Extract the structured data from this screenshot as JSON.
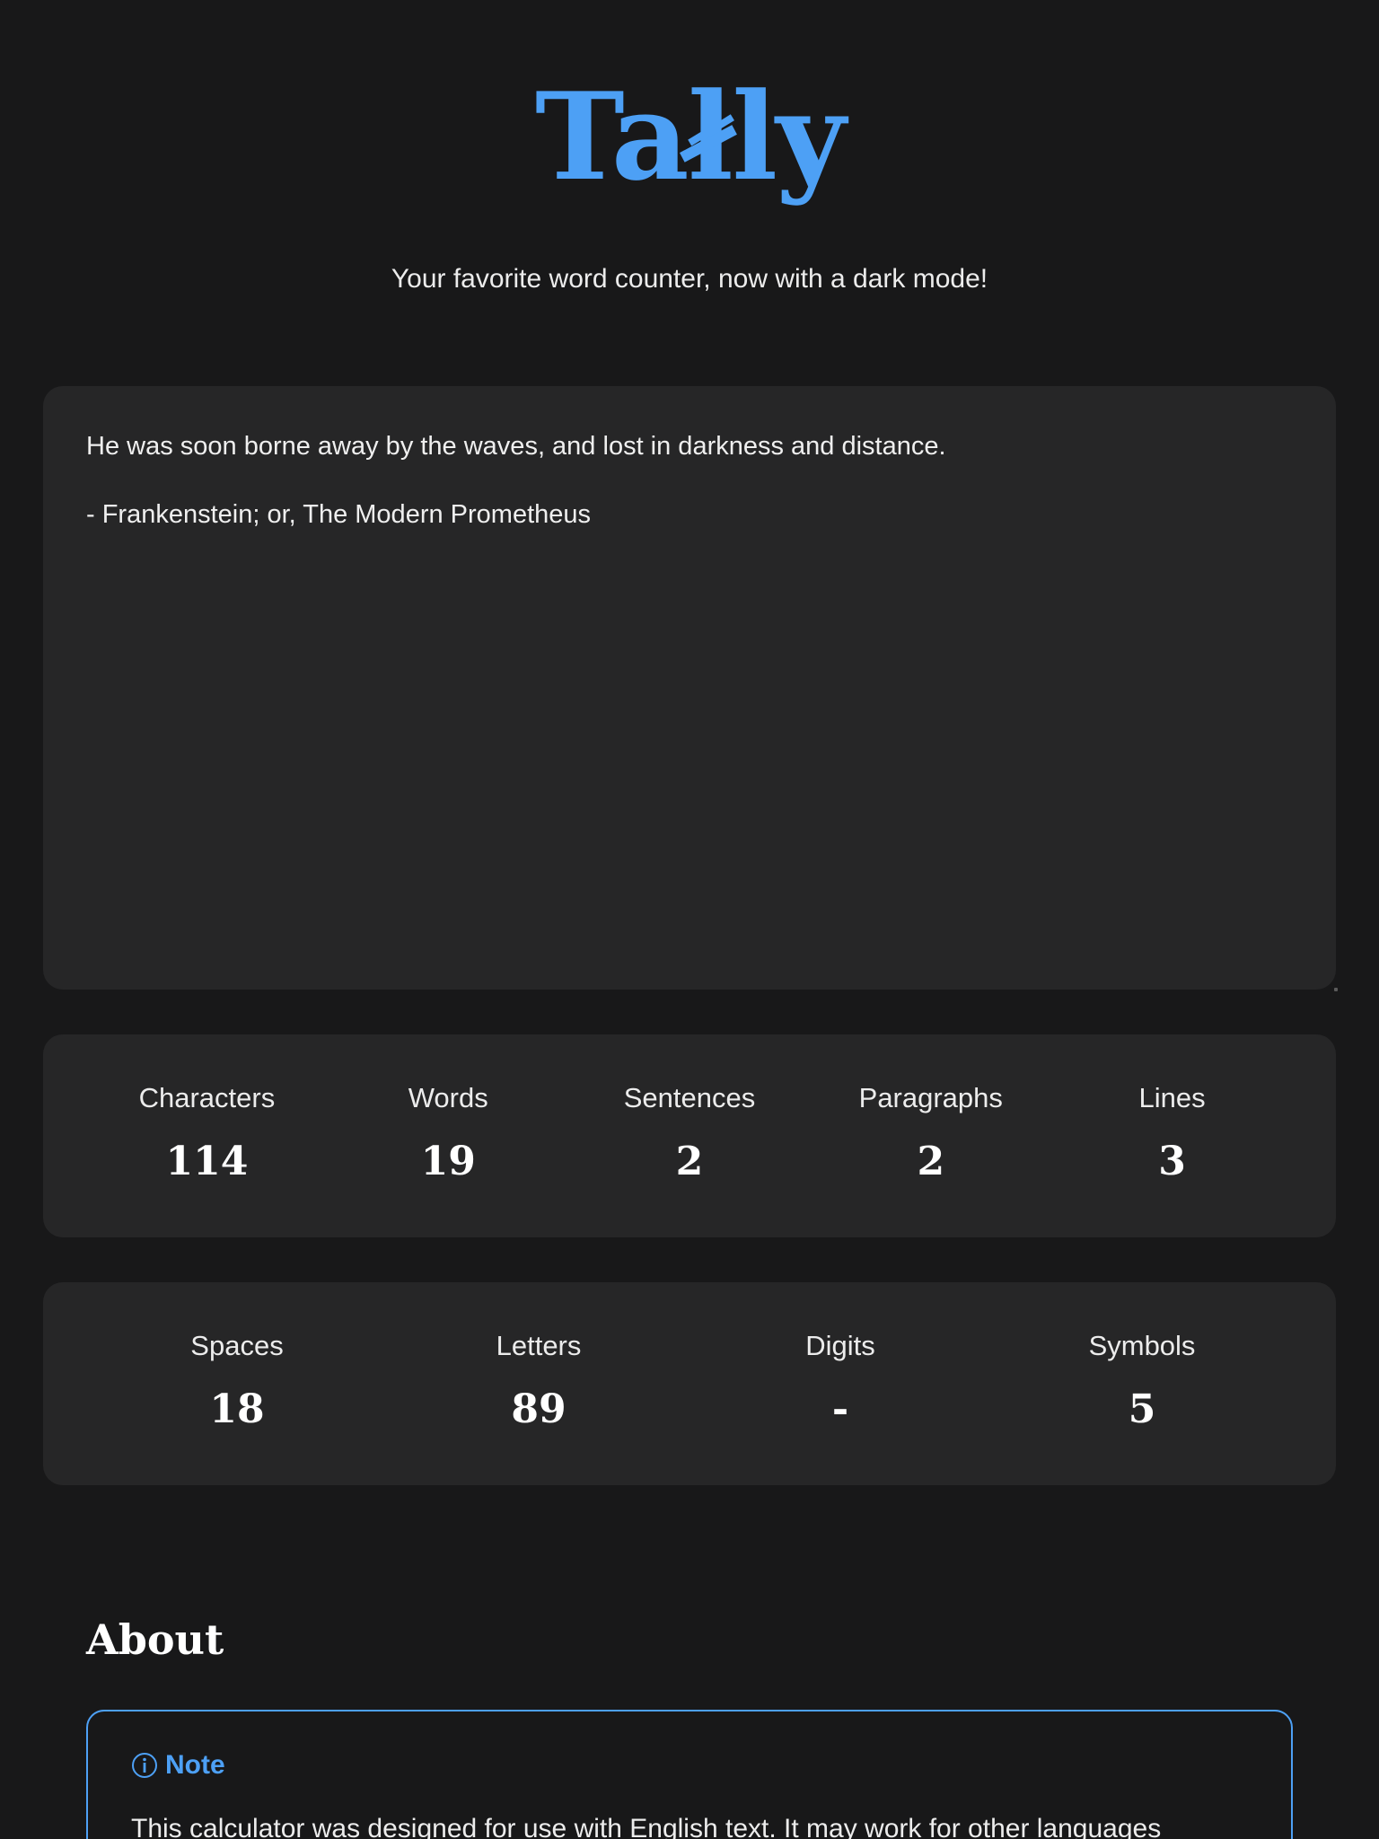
{
  "header": {
    "logo_prefix": "Ta",
    "logo_strike": "ł",
    "logo_suffix": "ly",
    "tagline": "Your favorite word counter, now with a dark mode!"
  },
  "editor": {
    "paragraphs": [
      "He was soon borne away by the waves, and lost in darkness and distance.",
      "- Frankenstein; or, The Modern Prometheus"
    ]
  },
  "stats_primary": [
    {
      "label": "Characters",
      "value": "114"
    },
    {
      "label": "Words",
      "value": "19"
    },
    {
      "label": "Sentences",
      "value": "2"
    },
    {
      "label": "Paragraphs",
      "value": "2"
    },
    {
      "label": "Lines",
      "value": "3"
    }
  ],
  "stats_secondary": [
    {
      "label": "Spaces",
      "value": "18"
    },
    {
      "label": "Letters",
      "value": "89"
    },
    {
      "label": "Digits",
      "value": "-"
    },
    {
      "label": "Symbols",
      "value": "5"
    }
  ],
  "about": {
    "heading": "About",
    "note_title": "Note",
    "note_icon": "info-circle-icon",
    "note_text": "This calculator was designed for use with English text. It may work for other languages"
  },
  "colors": {
    "accent": "#4da0f5",
    "background": "#181819",
    "panel": "#262627"
  }
}
